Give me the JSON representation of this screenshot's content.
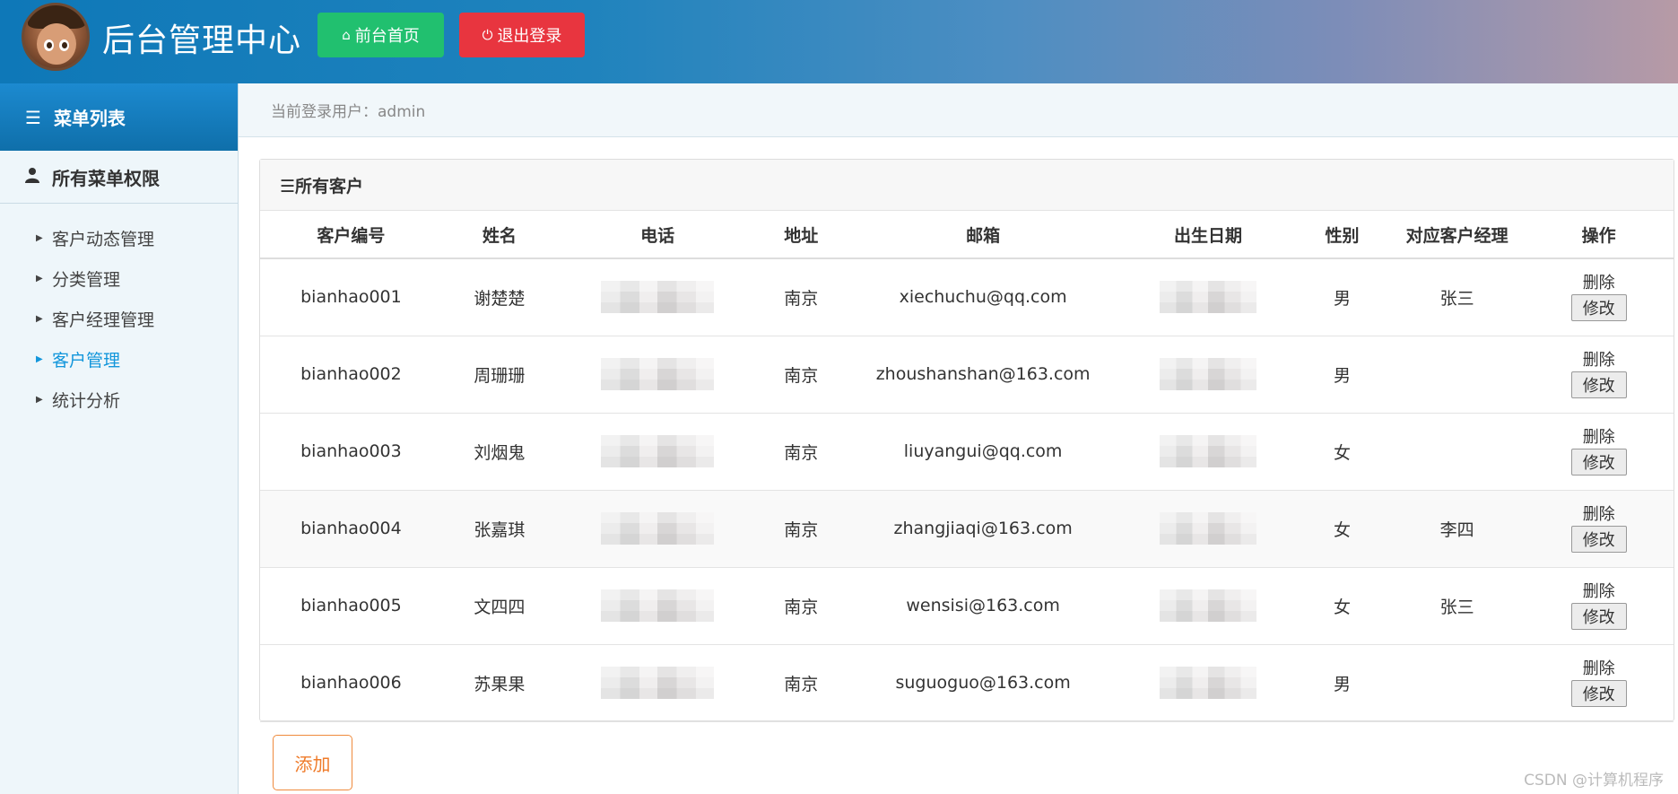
{
  "header": {
    "title": "后台管理中心",
    "home_label": "前台首页",
    "logout_label": "退出登录"
  },
  "sidebar": {
    "heading": "菜单列表",
    "group": "所有菜单权限",
    "items": [
      {
        "label": "客户动态管理",
        "active": false
      },
      {
        "label": "分类管理",
        "active": false
      },
      {
        "label": "客户经理管理",
        "active": false
      },
      {
        "label": "客户管理",
        "active": true
      },
      {
        "label": "统计分析",
        "active": false
      }
    ]
  },
  "topbar": {
    "current_user": "当前登录用户：admin"
  },
  "panel": {
    "title": "☰所有客户",
    "columns": [
      "客户编号",
      "姓名",
      "电话",
      "地址",
      "邮箱",
      "出生日期",
      "性别",
      "对应客户经理",
      "操作"
    ],
    "rows": [
      {
        "id": "bianhao001",
        "name": "谢楚楚",
        "address": "南京",
        "email": "xiechuchu@qq.com",
        "gender": "男",
        "manager": "张三"
      },
      {
        "id": "bianhao002",
        "name": "周珊珊",
        "address": "南京",
        "email": "zhoushanshan@163.com",
        "gender": "男",
        "manager": ""
      },
      {
        "id": "bianhao003",
        "name": "刘烟鬼",
        "address": "南京",
        "email": "liuyangui@qq.com",
        "gender": "女",
        "manager": ""
      },
      {
        "id": "bianhao004",
        "name": "张嘉琪",
        "address": "南京",
        "email": "zhangjiaqi@163.com",
        "gender": "女",
        "manager": "李四"
      },
      {
        "id": "bianhao005",
        "name": "文四四",
        "address": "南京",
        "email": "wensisi@163.com",
        "gender": "女",
        "manager": "张三"
      },
      {
        "id": "bianhao006",
        "name": "苏果果",
        "address": "南京",
        "email": "suguoguo@163.com",
        "gender": "男",
        "manager": ""
      }
    ],
    "delete_label": "删除",
    "edit_label": "修改"
  },
  "add_label": "添加",
  "watermark": "CSDN @计算机程序"
}
